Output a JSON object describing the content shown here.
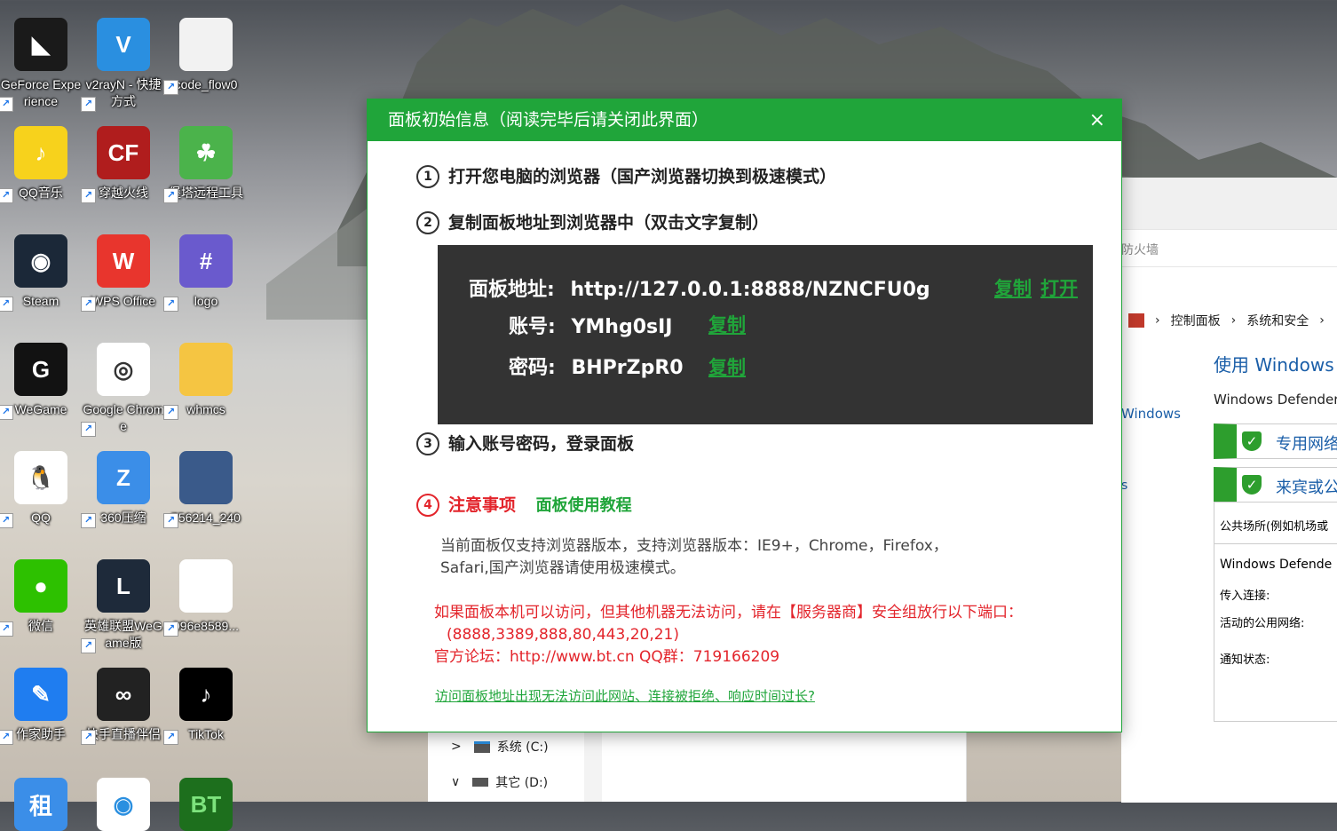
{
  "desktop_icons": [
    {
      "label": "GeForce Experience",
      "icon": "geforce-icon",
      "color": "#1a1a1a",
      "glyph": "◣"
    },
    {
      "label": "v2rayN - 快捷方式",
      "icon": "v2rayn-icon",
      "color": "#2a8fe0",
      "glyph": "V"
    },
    {
      "label": "code_flow0",
      "icon": "file-icon",
      "color": "#f2f2f2",
      "glyph": ""
    },
    {
      "label": "QQ音乐",
      "icon": "qqmusic-icon",
      "color": "#f7d21c",
      "glyph": "♪"
    },
    {
      "label": "穿越火线",
      "icon": "crossfire-icon",
      "color": "#b01d1d",
      "glyph": "CF"
    },
    {
      "label": "堡塔远程工具",
      "icon": "bt-remote-icon",
      "color": "#4bb34b",
      "glyph": "☘"
    },
    {
      "label": "Steam",
      "icon": "steam-icon",
      "color": "#1b2838",
      "glyph": "◉"
    },
    {
      "label": "WPS Office",
      "icon": "wps-icon",
      "color": "#e8352d",
      "glyph": "W"
    },
    {
      "label": "logo",
      "icon": "logo-icon",
      "color": "#6a5acd",
      "glyph": "#"
    },
    {
      "label": "WeGame",
      "icon": "wegame-icon",
      "color": "#121212",
      "glyph": "G"
    },
    {
      "label": "Google Chrome",
      "icon": "chrome-icon",
      "color": "#ffffff",
      "glyph": "◎"
    },
    {
      "label": "whmcs",
      "icon": "folder-icon",
      "color": "#f5c542",
      "glyph": ""
    },
    {
      "label": "QQ",
      "icon": "qq-icon",
      "color": "#ffffff",
      "glyph": "🐧"
    },
    {
      "label": "360压缩",
      "icon": "zip360-icon",
      "color": "#3b8ee8",
      "glyph": "Z"
    },
    {
      "label": "756214_240",
      "icon": "image-icon",
      "color": "#3a5a8a",
      "glyph": ""
    },
    {
      "label": "微信",
      "icon": "wechat-icon",
      "color": "#2dc100",
      "glyph": "●"
    },
    {
      "label": "英雄联盟WeGame版",
      "icon": "lol-icon",
      "color": "#1e2a3a",
      "glyph": "L"
    },
    {
      "label": "996e8589...",
      "icon": "document-icon",
      "color": "#ffffff",
      "glyph": ""
    },
    {
      "label": "作家助手",
      "icon": "writer-icon",
      "color": "#1f7df0",
      "glyph": "✎"
    },
    {
      "label": "快手直播伴侣",
      "icon": "kuaishou-icon",
      "color": "#222222",
      "glyph": "∞"
    },
    {
      "label": "TikTok",
      "icon": "tiktok-icon",
      "color": "#000000",
      "glyph": "♪"
    }
  ],
  "bottom_icons_glyphs": [
    "租",
    "◉",
    "BT"
  ],
  "background_window": {
    "firewall_title": "防火墙",
    "breadcrumb": [
      "控制面板",
      "系统和安全"
    ],
    "heading": "使用 Windows",
    "subheading": "Windows Defender",
    "side_link": "Windows",
    "side_s": "s",
    "network_private": "专用网络",
    "network_guest": "来宾或公",
    "public_desc": "公共场所(例如机场或",
    "defender_state": "Windows Defende",
    "incoming": "传入连接:",
    "active_public": "活动的公用网络:",
    "notify": "通知状态:",
    "drives": [
      {
        "label": "系统 (C:)",
        "chevron": ">"
      },
      {
        "label": "其它 (D:)",
        "chevron": "∨"
      }
    ]
  },
  "dialog": {
    "title": "面板初始信息（阅读完毕后请关闭此界面）",
    "close": "×",
    "step1": "打开您电脑的浏览器（国产浏览器切换到极速模式）",
    "step2": "复制面板地址到浏览器中（双击文字复制）",
    "step3": "输入账号密码，登录面板",
    "num1": "1",
    "num2": "2",
    "num3": "3",
    "num4": "4",
    "panel_url_label": "面板地址:",
    "panel_url": "http://127.0.0.1:8888/NZNCFU0g",
    "account_label": "账号:",
    "account": "YMhg0sIJ",
    "password_label": "密码:",
    "password": "BHPrZpR0",
    "copy": "复制",
    "open": "打开",
    "notice_title": "注意事项",
    "tutorial": "面板使用教程",
    "browser_note_1": "当前面板仅支持浏览器版本，支持浏览器版本：IE9+，Chrome，Firefox，",
    "browser_note_2": "Safari,国产浏览器请使用极速模式。",
    "red_note_1": "如果面板本机可以访问，但其他机器无法访问，请在【服务器商】安全组放行以下端口：",
    "red_note_2": "(8888,3389,888,80,443,20,21)",
    "red_note_3": "官方论坛：http://www.bt.cn  QQ群：719166209",
    "help_link": "访问面板地址出现无法访问此网站、连接被拒绝、响应时间过长?"
  },
  "colors": {
    "accent": "#20a53a",
    "panel_bg": "#333333",
    "red": "#e3242b"
  }
}
